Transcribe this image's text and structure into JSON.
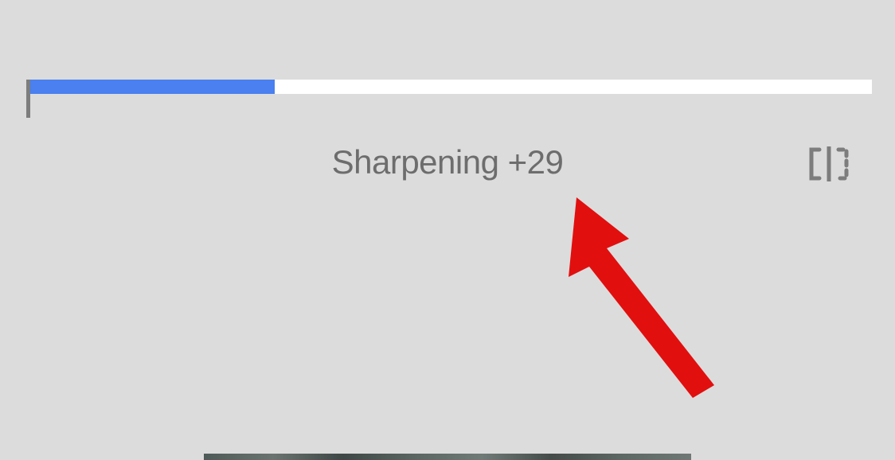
{
  "slider": {
    "percent": 29,
    "fill_color": "#4a80f0"
  },
  "adjustment": {
    "label": "Sharpening",
    "value": "+29"
  },
  "icons": {
    "compare": "compare-icon"
  }
}
